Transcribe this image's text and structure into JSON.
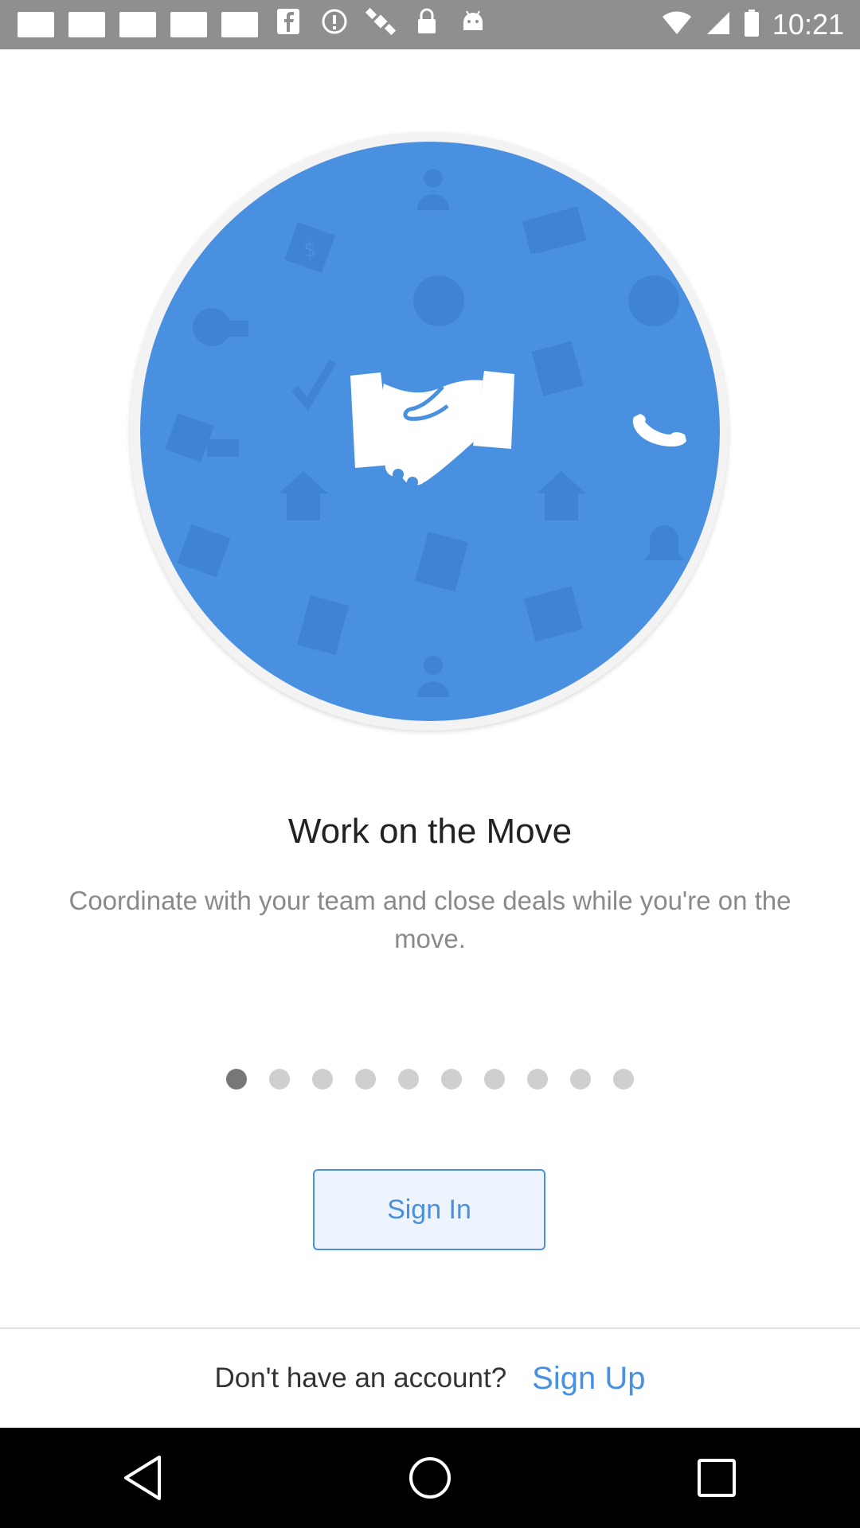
{
  "status_bar": {
    "time": "10:21",
    "icons": [
      "notification-square",
      "notification-square",
      "notification-square",
      "notification-square",
      "notification-square",
      "facebook-icon",
      "info-icon",
      "satellite-icon",
      "lock-icon",
      "android-icon",
      "wifi-icon",
      "signal-icon",
      "battery-icon"
    ]
  },
  "hero": {
    "circle_color": "#4a90e0",
    "center_icon": "handshake-icon",
    "accent_icon": "phone-icon",
    "background_icons": [
      "person-icon",
      "dollar-icon",
      "mail-icon",
      "money-bag-icon",
      "person-icon",
      "check-icon",
      "document-icon",
      "dollar-icon",
      "home-icon",
      "home-icon",
      "dollar-icon",
      "document-icon",
      "bell-icon",
      "building-icon",
      "document-icon",
      "person-icon"
    ]
  },
  "onboarding": {
    "title": "Work on the Move",
    "description": "Coordinate with your team and close deals while you're on the move.",
    "page_count": 10,
    "active_page": 1
  },
  "actions": {
    "sign_in_label": "Sign In",
    "no_account_text": "Don't have an account?",
    "sign_up_label": "Sign Up",
    "accent_color": "#4a90e0"
  },
  "nav_bar": {
    "buttons": [
      "back-icon",
      "home-icon",
      "recents-icon"
    ]
  }
}
